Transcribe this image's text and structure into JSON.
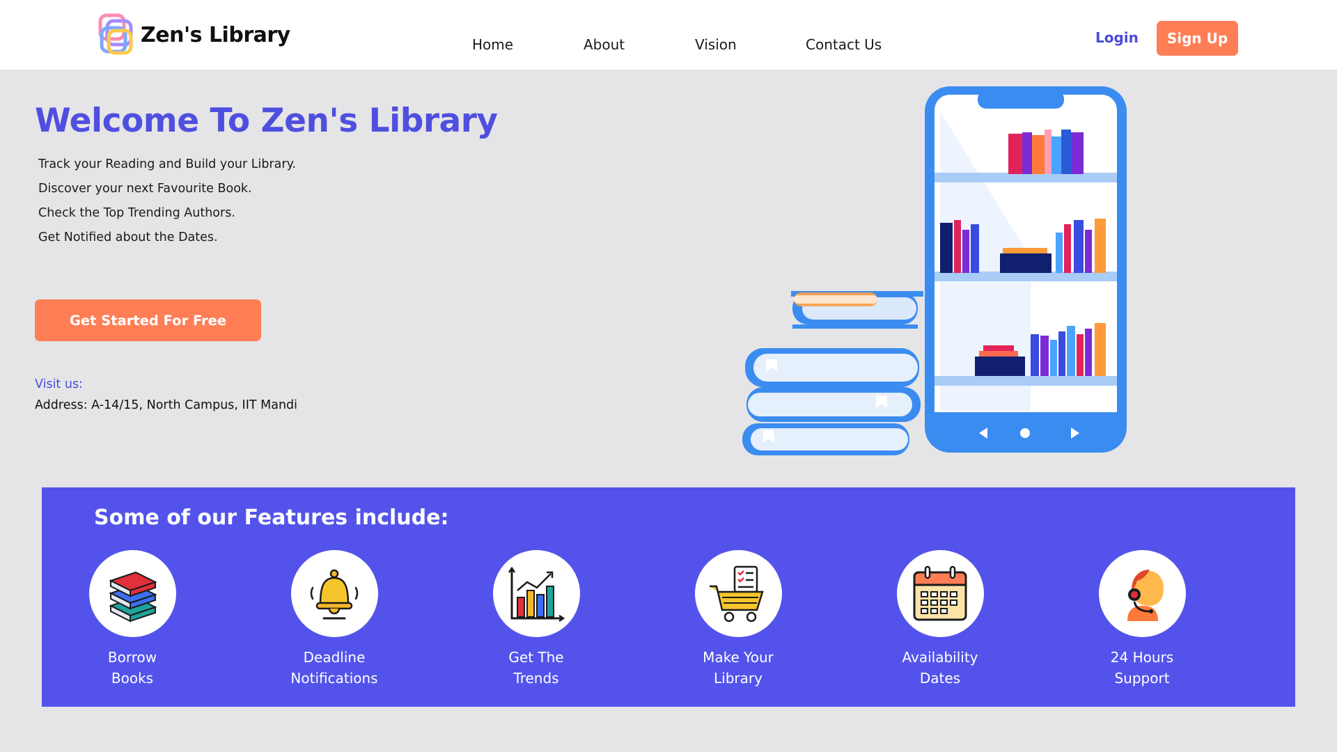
{
  "brand": {
    "name": "Zen's Library"
  },
  "nav": {
    "items": [
      {
        "label": "Home"
      },
      {
        "label": "About"
      },
      {
        "label": "Vision"
      },
      {
        "label": "Contact Us"
      }
    ],
    "login_label": "Login",
    "signup_label": "Sign Up"
  },
  "hero": {
    "title": "Welcome To Zen's Library",
    "lines": [
      "Track your Reading and Build your Library.",
      "Discover your next Favourite Book.",
      "Check the Top Trending Authors.",
      "Get Notified about the Dates."
    ],
    "cta_label": "Get Started For Free",
    "visit_label": "Visit us:",
    "address": "Address: A-14/15, North Campus, IIT Mandi"
  },
  "features": {
    "title": "Some of our Features include:",
    "items": [
      {
        "line1": "Borrow",
        "line2": "Books",
        "icon": "books-stack-icon"
      },
      {
        "line1": "Deadline",
        "line2": "Notifications",
        "icon": "bell-icon"
      },
      {
        "line1": "Get The",
        "line2": "Trends",
        "icon": "bar-chart-icon"
      },
      {
        "line1": "Make Your",
        "line2": "Library",
        "icon": "cart-checklist-icon"
      },
      {
        "line1": "Availability",
        "line2": "Dates",
        "icon": "calendar-icon"
      },
      {
        "line1": "24 Hours",
        "line2": "Support",
        "icon": "headset-support-icon"
      }
    ]
  },
  "colors": {
    "accent": "#4f4fdf",
    "cta": "#ff7e56",
    "features_bg": "#5353eb",
    "page_bg": "#e5e5e7"
  }
}
